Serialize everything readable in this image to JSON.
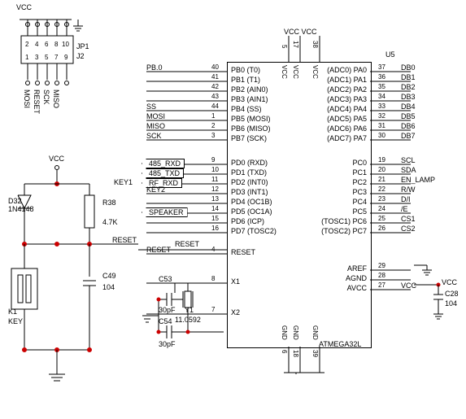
{
  "power": {
    "vcc": "VCC",
    "vcc_vcc": "VCC VCC"
  },
  "header": {
    "ref": "JP1",
    "ref2": "J2",
    "top_pins": [
      "2",
      "4",
      "6",
      "8",
      "10"
    ],
    "bot_pins": [
      "1",
      "3",
      "5",
      "7",
      "9"
    ],
    "bot_nets": [
      "MOSI",
      "RESET",
      "SCK",
      "MISO",
      ""
    ]
  },
  "mcu": {
    "part": "ATMEGA32L",
    "ref": "U5",
    "left_pins": [
      {
        "net": "PB.0",
        "num": "40",
        "fn": "PB0 (T0)"
      },
      {
        "net": "",
        "num": "41",
        "fn": "PB1 (T1)"
      },
      {
        "net": "",
        "num": "42",
        "fn": "PB2 (AIN0)"
      },
      {
        "net": "",
        "num": "43",
        "fn": "PB3 (AIN1)"
      },
      {
        "net": "SS",
        "num": "44",
        "fn": "PB4 (SS)"
      },
      {
        "net": "MOSI",
        "num": "1",
        "fn": "PB5 (MOSI)"
      },
      {
        "net": "MISO",
        "num": "2",
        "fn": "PB6 (MISO)"
      },
      {
        "net": "SCK",
        "num": "3",
        "fn": "PB7 (SCK)"
      },
      {
        "net": "485_RXD",
        "num": "9",
        "fn": "PD0 (RXD)",
        "tag": true
      },
      {
        "net": "485_TXD",
        "num": "10",
        "fn": "PD1 (TXD)",
        "tag": true
      },
      {
        "net": "RF_RXD",
        "num": "11",
        "fn": "PD2 (INT0)",
        "tag": true,
        "extra": "KEY1"
      },
      {
        "net": "KEY2",
        "num": "12",
        "fn": "PD3 (INT1)"
      },
      {
        "net": "",
        "num": "13",
        "fn": "PD4 (OC1B)"
      },
      {
        "net": "SPEAKER",
        "num": "14",
        "fn": "PD5 (OC1A)",
        "tag": true
      },
      {
        "net": "",
        "num": "15",
        "fn": "PD6 (ICP)"
      },
      {
        "net": "",
        "num": "16",
        "fn": "PD7 (TOSC2)"
      },
      {
        "net": "RESET",
        "num": "4",
        "fn": "RESET"
      },
      {
        "net": "",
        "num": "8",
        "fn": "X1"
      },
      {
        "net": "",
        "num": "7",
        "fn": "X2"
      }
    ],
    "right_pins": [
      {
        "num": "37",
        "net": "DB0",
        "fn": "(ADC0) PA0"
      },
      {
        "num": "36",
        "net": "DB1",
        "fn": "(ADC1) PA1"
      },
      {
        "num": "35",
        "net": "DB2",
        "fn": "(ADC2) PA2"
      },
      {
        "num": "34",
        "net": "DB3",
        "fn": "(ADC3) PA3"
      },
      {
        "num": "33",
        "net": "DB4",
        "fn": "(ADC4) PA4"
      },
      {
        "num": "32",
        "net": "DB5",
        "fn": "(ADC5) PA5"
      },
      {
        "num": "31",
        "net": "DB6",
        "fn": "(ADC6) PA6"
      },
      {
        "num": "30",
        "net": "DB7",
        "fn": "(ADC7) PA7"
      },
      {
        "num": "19",
        "net": "SCL",
        "fn": "PC0"
      },
      {
        "num": "20",
        "net": "SDA",
        "fn": "PC1"
      },
      {
        "num": "21",
        "net": "EN_LAMP",
        "fn": "PC2"
      },
      {
        "num": "22",
        "net": "R/W",
        "fn": "PC3"
      },
      {
        "num": "23",
        "net": "D/I",
        "fn": "PC4"
      },
      {
        "num": "24",
        "net": "/E",
        "fn": "PC5"
      },
      {
        "num": "25",
        "net": "CS1",
        "fn": "(TOSC1) PC6"
      },
      {
        "num": "26",
        "net": "CS2",
        "fn": "(TOSC2) PC7"
      },
      {
        "num": "29",
        "net": "",
        "fn": "AREF"
      },
      {
        "num": "28",
        "net": "",
        "fn": "AGND"
      },
      {
        "num": "27",
        "net": "VCC",
        "fn": "AVCC"
      }
    ],
    "top_pins": [
      {
        "num": "5",
        "fn": "VCC"
      },
      {
        "num": "17",
        "fn": "VCC"
      },
      {
        "num": "38",
        "fn": "VCC"
      }
    ],
    "bot_pins": [
      {
        "num": "6",
        "fn": "GND"
      },
      {
        "num": "18",
        "fn": "GND"
      },
      {
        "num": "39",
        "fn": "GND"
      }
    ]
  },
  "reset_ckt": {
    "diode": {
      "ref": "D32",
      "part": "1N4148"
    },
    "r": {
      "ref": "R38",
      "val": "4.7K"
    },
    "sw": {
      "ref": "K1",
      "val": "KEY"
    },
    "c": {
      "ref": "C49",
      "val": "104"
    },
    "net": "RESET"
  },
  "xtal_ckt": {
    "c1": {
      "ref": "C53",
      "val": "30pF"
    },
    "c2": {
      "ref": "C54",
      "val": "30pF"
    },
    "y": {
      "ref": "Y1",
      "val": "11.0592"
    }
  },
  "avcc_ckt": {
    "c": {
      "ref": "C28",
      "val": "104"
    }
  },
  "labels": {
    "reset_wire": "RESET"
  }
}
